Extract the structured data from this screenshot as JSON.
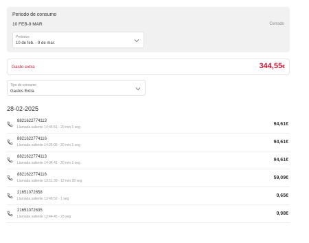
{
  "period": {
    "title": "Periodo de consumo",
    "range": "10 FEB-9 MAR",
    "status": "Cerrado",
    "select_caption": "Periodos",
    "select_value": "10 de feb. - 9 de mar."
  },
  "extra": {
    "label": "Gasto extra",
    "amount": "344,55",
    "currency": "€"
  },
  "type_filter": {
    "caption": "Tipo de consumo",
    "value": "Gastos Extra"
  },
  "date": "28-02-2025",
  "calls": [
    {
      "number": "8821622774113",
      "detail": "Llamada saliente 14:45:51 - 20 min 1 seg",
      "amount": "94,61€"
    },
    {
      "number": "8821622774116",
      "detail": "Llamada saliente 14:25:05 - 20 min 1 seg",
      "amount": "94,61€"
    },
    {
      "number": "8821622774113",
      "detail": "Llamada saliente 14:04:41 - 20 min 1 seg",
      "amount": "94,61€"
    },
    {
      "number": "8821622774116",
      "detail": "Llamada saliente 13:51:39 - 12 min 28 seg",
      "amount": "59,09€"
    },
    {
      "number": "21651072658",
      "detail": "Llamada saliente 13:48:52 - 1 seg",
      "amount": "0,65€"
    },
    {
      "number": "21651072635",
      "detail": "Llamada saliente 13:44:45 - 23 seg",
      "amount": "0,98€"
    }
  ],
  "icons": {
    "chevron": "chevron-down-icon",
    "phone": "phone-icon"
  },
  "colors": {
    "accent": "#c4122f",
    "card_bg": "#f1f1f1"
  }
}
